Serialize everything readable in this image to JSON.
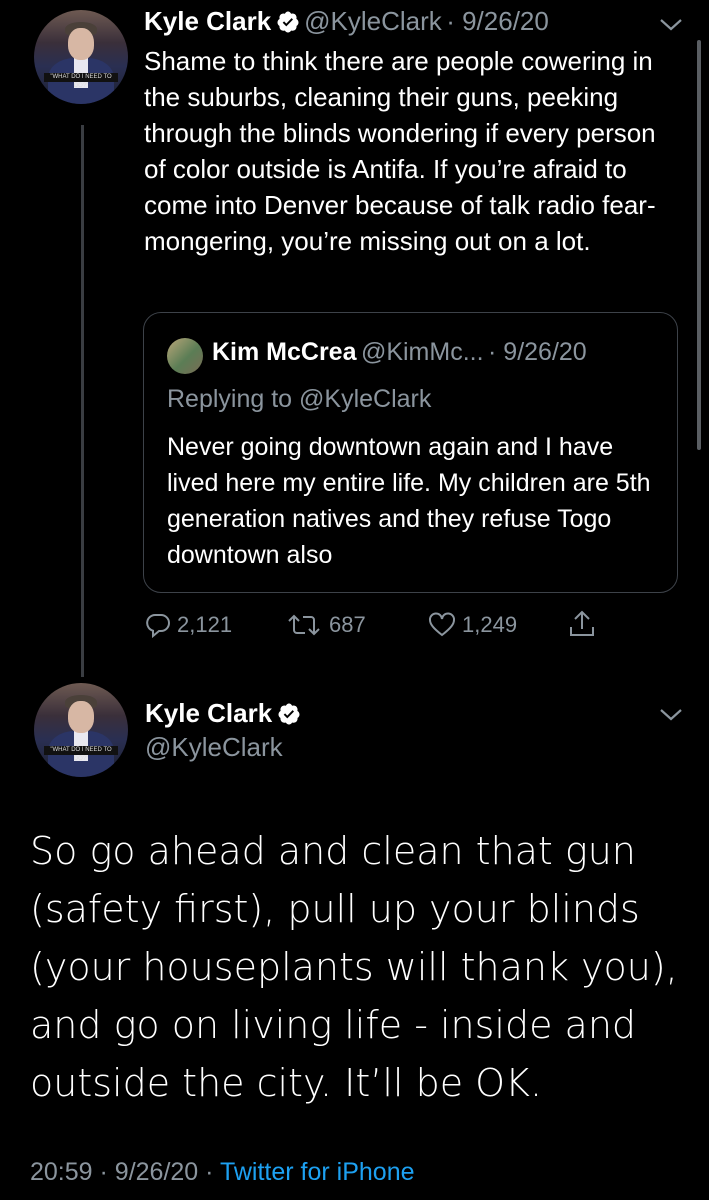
{
  "tweet1": {
    "author_name": "Kyle Clark",
    "handle": "@KyleClark",
    "date": "· 9/26/20",
    "avatar_banner": "\"WHAT DO I NEED TO DO?\"",
    "text": "Shame to think there are people cowering in the suburbs, cleaning their guns, peeking through the blinds wondering if every person of color outside is Antifa. If you’re afraid to come into Denver because of talk radio fear-mongering, you’re missing out on a lot.",
    "quoted": {
      "author_name": "Kim McCrea",
      "handle": "@KimMc...",
      "date": "· 9/26/20",
      "replying_to": "Replying to @KyleClark",
      "text": "Never going downtown again and I have lived here my entire life. My children are 5th generation natives and they refuse Togo downtown also"
    },
    "actions": {
      "replies": "2,121",
      "retweets": "687",
      "likes": "1,249"
    }
  },
  "tweet2": {
    "author_name": "Kyle Clark",
    "handle": "@KyleClark",
    "avatar_banner": "\"WHAT DO I NEED TO DO?\"",
    "text": "So go ahead and clean that gun (safety first), pull up your blinds (your houseplants will thank you), and go on living life - inside and outside the city. It’ll be OK.",
    "time": "20:59",
    "date": "· 9/26/20 ·",
    "source": "Twitter for iPhone"
  },
  "colors": {
    "background": "#000000",
    "text": "#ffffff",
    "secondary": "#8b959e",
    "link": "#1da1f2",
    "thread_line": "#3a3d42"
  },
  "icons": [
    "verified-badge-icon",
    "chevron-down-icon",
    "reply-icon",
    "retweet-icon",
    "like-icon",
    "share-icon"
  ]
}
